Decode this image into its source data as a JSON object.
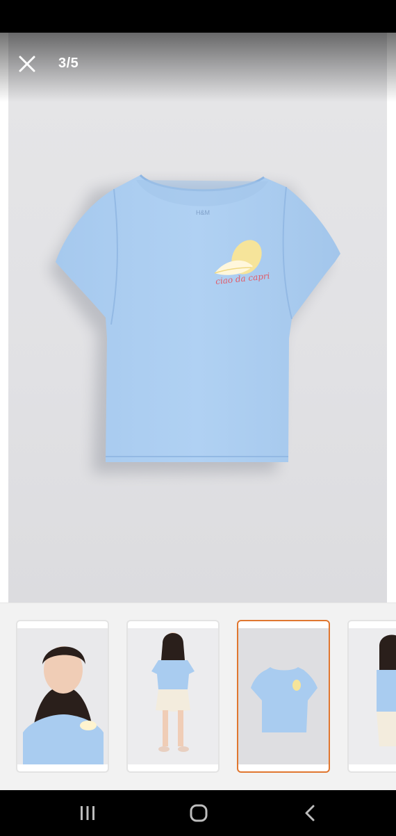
{
  "viewer": {
    "counter": "3/5",
    "print_text": "ciao da capri"
  },
  "icons": {
    "close": "close-icon",
    "recents": "recents-icon",
    "home": "home-icon",
    "back": "back-icon"
  },
  "thumbnails": [
    {
      "name": "thumb-closeup",
      "active": false
    },
    {
      "name": "thumb-fullbody",
      "active": false
    },
    {
      "name": "thumb-product",
      "active": true
    },
    {
      "name": "thumb-partial",
      "active": false
    }
  ],
  "colors": {
    "accent": "#e0762f",
    "shirt": "#a9ccf0",
    "background": "#e3e3e6"
  }
}
